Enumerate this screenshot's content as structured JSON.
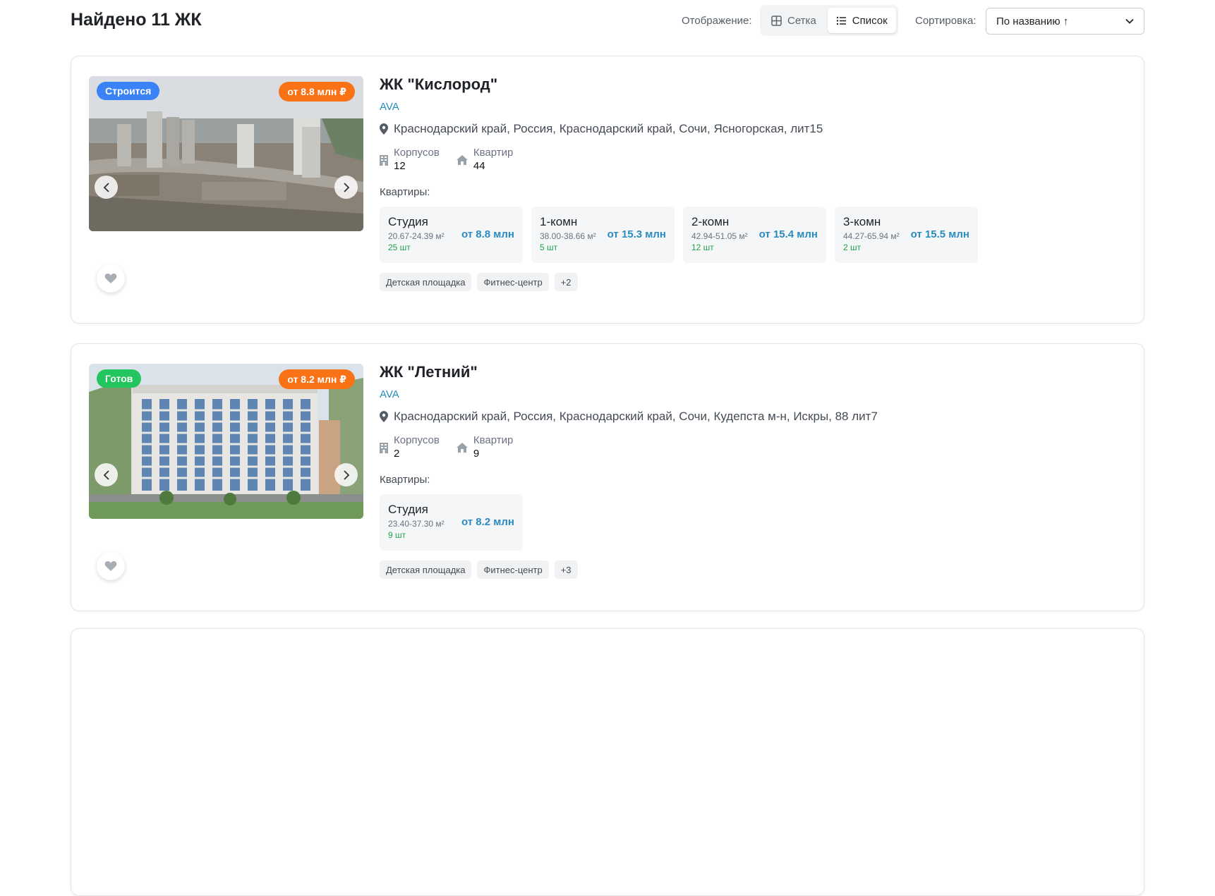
{
  "header": {
    "title": "Найдено 11 ЖК",
    "view_label": "Отображение:",
    "view_grid": "Сетка",
    "view_list": "Список",
    "sort_label": "Сортировка:",
    "sort_value": "По названию ↑"
  },
  "complexes": [
    {
      "name": "ЖК \"Кислород\"",
      "developer": "AVA",
      "status": "Строится",
      "price_badge": "от 8.8 млн ₽",
      "address": "Краснодарский край, Россия, Краснодарский край, Сочи, Ясногорская, лит15",
      "buildings_label": "Корпусов",
      "buildings": "12",
      "flats_label": "Квартир",
      "flats": "44",
      "apartments_label": "Квартиры:",
      "apartments": [
        {
          "type": "Студия",
          "area": "20.67-24.39 м²",
          "count": "25 шт",
          "price": "от 8.8 млн"
        },
        {
          "type": "1-комн",
          "area": "38.00-38.66 м²",
          "count": "5 шт",
          "price": "от 15.3 млн"
        },
        {
          "type": "2-комн",
          "area": "42.94-51.05 м²",
          "count": "12 шт",
          "price": "от 15.4 млн"
        },
        {
          "type": "3-комн",
          "area": "44.27-65.94 м²",
          "count": "2 шт",
          "price": "от 15.5 млн"
        }
      ],
      "tags": [
        "Детская площадка",
        "Фитнес-центр",
        "+2"
      ]
    },
    {
      "name": "ЖК \"Летний\"",
      "developer": "AVA",
      "status": "Готов",
      "price_badge": "от 8.2 млн ₽",
      "address": "Краснодарский край, Россия, Краснодарский край, Сочи, Кудепста м-н, Искры, 88 лит7",
      "buildings_label": "Корпусов",
      "buildings": "2",
      "flats_label": "Квартир",
      "flats": "9",
      "apartments_label": "Квартиры:",
      "apartments": [
        {
          "type": "Студия",
          "area": "23.40-37.30 м²",
          "count": "9 шт",
          "price": "от 8.2 млн"
        }
      ],
      "tags": [
        "Детская площадка",
        "Фитнес-центр",
        "+3"
      ]
    }
  ],
  "colors": {
    "status_building": "#3b82f6",
    "status_ready": "#22c55e",
    "price_badge": "#f97316",
    "link": "#2a8bc0",
    "count": "#22a249"
  },
  "icons": [
    "grid-icon",
    "list-icon",
    "map-pin-icon",
    "building-icon",
    "home-icon",
    "chevron-left-icon",
    "chevron-right-icon",
    "heart-icon"
  ]
}
